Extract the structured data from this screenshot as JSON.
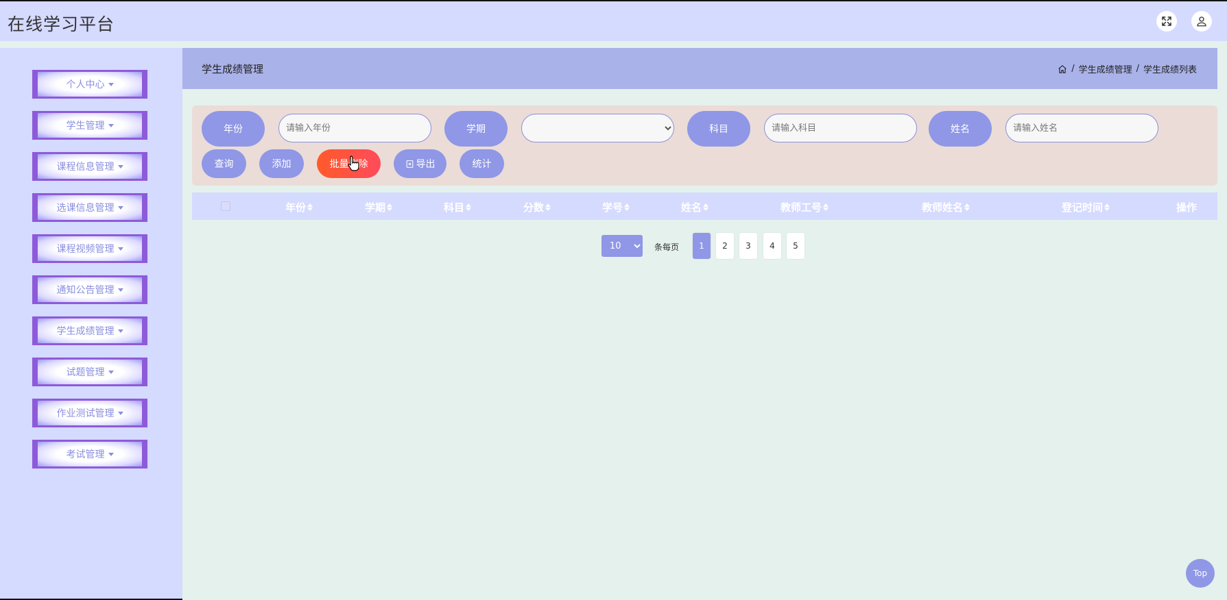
{
  "app": {
    "title": "在线学习平台"
  },
  "sidebar": {
    "items": [
      {
        "label": "个人中心"
      },
      {
        "label": "学生管理"
      },
      {
        "label": "课程信息管理"
      },
      {
        "label": "选课信息管理"
      },
      {
        "label": "课程视频管理"
      },
      {
        "label": "通知公告管理"
      },
      {
        "label": "学生成绩管理"
      },
      {
        "label": "试题管理"
      },
      {
        "label": "作业测试管理"
      },
      {
        "label": "考试管理"
      }
    ]
  },
  "header": {
    "page_title": "学生成绩管理",
    "breadcrumb": [
      "学生成绩管理",
      "学生成绩列表"
    ],
    "separator": "/"
  },
  "search": {
    "year_label": "年份",
    "year_placeholder": "请输入年份",
    "term_label": "学期",
    "term_value": "",
    "subject_label": "科目",
    "subject_placeholder": "请输入科目",
    "name_label": "姓名",
    "name_placeholder": "请输入姓名"
  },
  "actions": {
    "query": "查询",
    "add": "添加",
    "batch_delete": "批量删除",
    "export": "导出",
    "stats": "统计"
  },
  "table": {
    "columns": [
      "年份",
      "学期",
      "科目",
      "分数",
      "学号",
      "姓名",
      "教师工号",
      "教师姓名",
      "登记时间",
      "操作"
    ]
  },
  "pagination": {
    "page_size": "10",
    "per_page_label": "条每页",
    "pages": [
      "1",
      "2",
      "3",
      "4",
      "5"
    ],
    "current": "1"
  },
  "back_to_top": "Top",
  "colors": {
    "accent": "#8f97e6",
    "sidebar_bg": "#d5daff",
    "danger": "#ff5a2a",
    "menu_border": "#8e5ad9"
  }
}
